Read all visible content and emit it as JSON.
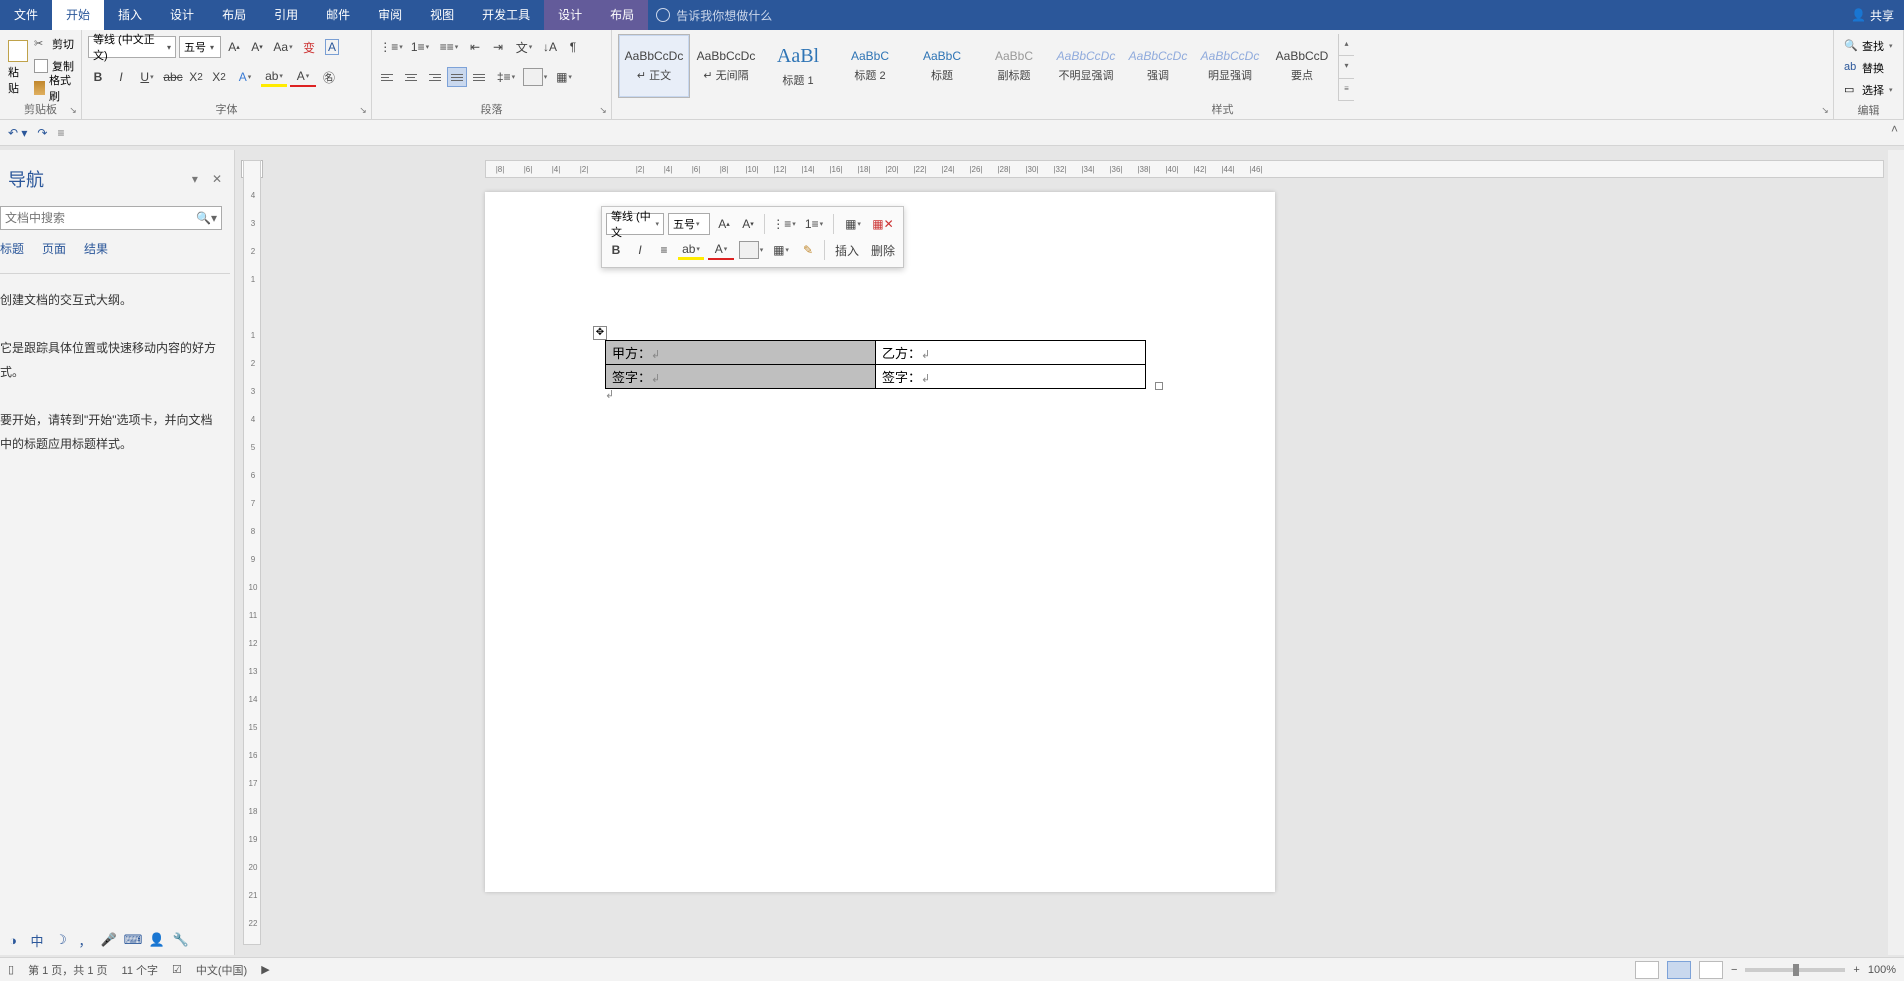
{
  "tabs": {
    "file": "文件",
    "home": "开始",
    "insert": "插入",
    "design": "设计",
    "layout": "布局",
    "references": "引用",
    "mailings": "邮件",
    "review": "审阅",
    "view": "视图",
    "developer": "开发工具",
    "design2": "设计",
    "layout2": "布局",
    "tellme_placeholder": "告诉我你想做什么",
    "share": "共享"
  },
  "clipboard": {
    "paste": "粘贴",
    "cut": "剪切",
    "copy": "复制",
    "format_painter": "格式刷",
    "group": "剪贴板"
  },
  "font": {
    "name": "等线 (中文正文)",
    "size": "五号",
    "group": "字体"
  },
  "paragraph": {
    "group": "段落"
  },
  "styles": {
    "group": "样式",
    "items": [
      {
        "preview": "AaBbCcDc",
        "label": "↵ 正文",
        "cls": ""
      },
      {
        "preview": "AaBbCcDc",
        "label": "↵ 无间隔",
        "cls": ""
      },
      {
        "preview": "AaBl",
        "label": "标题 1",
        "cls": "big blue"
      },
      {
        "preview": "AaBbC",
        "label": "标题 2",
        "cls": "blue"
      },
      {
        "preview": "AaBbC",
        "label": "标题",
        "cls": "blue"
      },
      {
        "preview": "AaBbC",
        "label": "副标题",
        "cls": "gray"
      },
      {
        "preview": "AaBbCcDc",
        "label": "不明显强调",
        "cls": "faint"
      },
      {
        "preview": "AaBbCcDc",
        "label": "强调",
        "cls": "faint"
      },
      {
        "preview": "AaBbCcDc",
        "label": "明显强调",
        "cls": "faint"
      },
      {
        "preview": "AaBbCcD",
        "label": "要点",
        "cls": ""
      }
    ]
  },
  "editing": {
    "find": "查找",
    "replace": "替换",
    "select": "选择",
    "group": "编辑"
  },
  "nav": {
    "title": "导航",
    "search_placeholder": "文档中搜索",
    "tab_headings": "标题",
    "tab_pages": "页面",
    "tab_results": "结果",
    "line1": "创建文档的交互式大纲。",
    "line2": "它是跟踪具体位置或快速移动内容的好方式。",
    "line3": "要开始，请转到\"开始\"选项卡，并向文档中的标题应用标题样式。"
  },
  "mini": {
    "font": "等线 (中文",
    "size": "五号",
    "insert": "插入",
    "delete": "删除"
  },
  "table": {
    "r1c1": "甲方：",
    "r1c2": "乙方：",
    "r2c1": "签字：",
    "r2c2": "签字："
  },
  "ruler_h": [
    "|8|",
    "|6|",
    "|4|",
    "|2|",
    "",
    "|2|",
    "|4|",
    "|6|",
    "|8|",
    "|10|",
    "|12|",
    "|14|",
    "|16|",
    "|18|",
    "|20|",
    "|22|",
    "|24|",
    "|26|",
    "|28|",
    "|30|",
    "|32|",
    "|34|",
    "|36|",
    "|38|",
    "|40|",
    "|42|",
    "|44|",
    "|46|"
  ],
  "ruler_v": [
    "4",
    "3",
    "2",
    "1",
    "",
    "1",
    "2",
    "3",
    "4",
    "5",
    "6",
    "7",
    "8",
    "9",
    "10",
    "11",
    "12",
    "13",
    "14",
    "15",
    "16",
    "17",
    "18",
    "19",
    "20",
    "21",
    "22"
  ],
  "status": {
    "page": "第 1 页，共 1 页",
    "words": "11 个字",
    "lang": "中文(中国)",
    "zoom": "100%"
  }
}
